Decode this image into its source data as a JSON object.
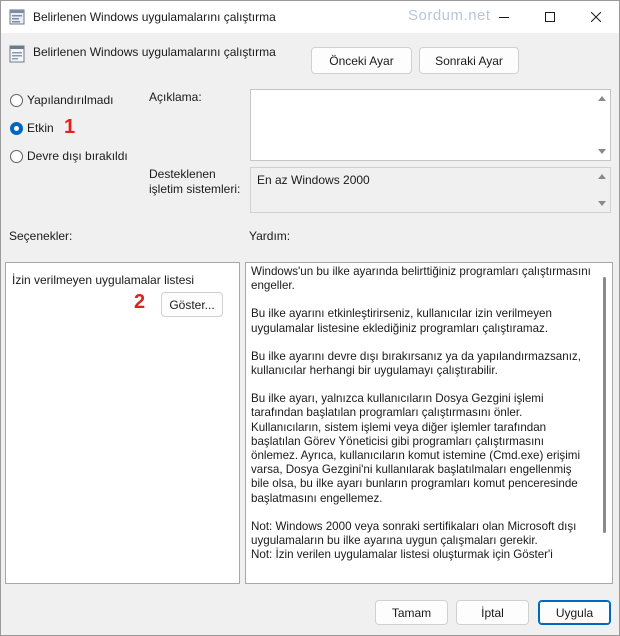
{
  "window": {
    "title": "Belirlenen Windows uygulamalarını çalıştırma",
    "watermark": "Sordum.net"
  },
  "header": {
    "title": "Belirlenen Windows uygulamalarını çalıştırma",
    "prev_label": "Önceki Ayar",
    "next_label": "Sonraki Ayar"
  },
  "state": {
    "options": [
      {
        "label": "Yapılandırılmadı",
        "checked": false
      },
      {
        "label": "Etkin",
        "checked": true
      },
      {
        "label": "Devre dışı bırakıldı",
        "checked": false
      }
    ]
  },
  "annotations": {
    "mark1": "1",
    "mark2": "2"
  },
  "description": {
    "label": "Açıklama:",
    "value": ""
  },
  "supported": {
    "label": "Desteklenen\nişletim sistemleri:",
    "value": "En az Windows 2000"
  },
  "options_section": {
    "label": "Seçenekler:",
    "list_label": "İzin verilmeyen uygulamalar listesi",
    "show_button": "Göster..."
  },
  "help": {
    "label": "Yardım:",
    "paragraphs": [
      "Windows'un bu ilke ayarında belirttiğiniz programları çalıştırmasını engeller.",
      "Bu ilke ayarını etkinleştirirseniz, kullanıcılar izin verilmeyen uygulamalar listesine eklediğiniz programları çalıştıramaz.",
      "Bu ilke ayarını devre dışı bırakırsanız ya da yapılandırmazsanız, kullanıcılar herhangi bir uygulamayı çalıştırabilir.",
      "Bu ilke ayarı, yalnızca kullanıcıların Dosya Gezgini işlemi tarafından başlatılan programları çalıştırmasını önler. Kullanıcıların, sistem işlemi veya diğer işlemler tarafından başlatılan Görev Yöneticisi gibi programları çalıştırmasını önlemez.  Ayrıca, kullanıcıların komut istemine (Cmd.exe) erişimi varsa, Dosya Gezgini'ni kullanılarak başlatılmaları engellenmiş bile olsa, bu ilke ayarı bunların programları komut penceresinde başlatmasını engellemez.",
      "Not: Windows 2000 veya sonraki sertifikaları olan Microsoft dışı uygulamaların bu ilke ayarına uygun çalışmaları gerekir.",
      "Not: İzin verilen uygulamalar listesi oluşturmak için Göster'i"
    ]
  },
  "footer": {
    "ok_label": "Tamam",
    "cancel_label": "İptal",
    "apply_label": "Uygula"
  },
  "colors": {
    "accent": "#0067c0",
    "annotation": "#e0221c"
  }
}
